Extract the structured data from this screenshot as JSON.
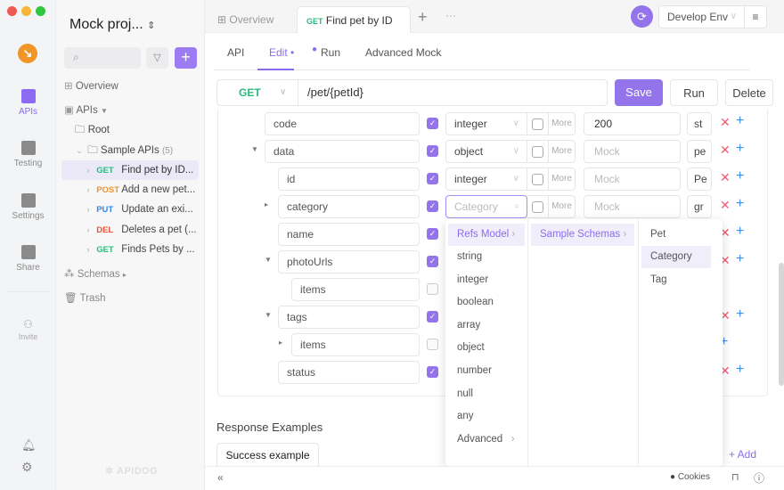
{
  "window": {
    "traffic_colors": [
      "#ee5b55",
      "#f6b53b",
      "#2fc640"
    ]
  },
  "rail": {
    "items": [
      {
        "label": "APIs",
        "icon": "apis-icon",
        "active": true
      },
      {
        "label": "Testing",
        "icon": "testing-icon",
        "active": false
      },
      {
        "label": "Settings",
        "icon": "settings-icon",
        "active": false
      },
      {
        "label": "Share",
        "icon": "share-icon",
        "active": false
      },
      {
        "label": "Invite",
        "icon": "invite-icon",
        "active": false
      }
    ]
  },
  "sidebar": {
    "project": "Mock proj...",
    "project_chevron": "⌃",
    "overview": "Overview",
    "apis": "APIs",
    "root": "Root",
    "folder": "Sample APIs",
    "folder_count": "(5)",
    "endpoints": [
      {
        "method": "GET",
        "label": "Find pet by ID..."
      },
      {
        "method": "POST",
        "label": "Add a new pet..."
      },
      {
        "method": "PUT",
        "label": "Update an exi..."
      },
      {
        "method": "DEL",
        "label": "Deletes a pet (..."
      },
      {
        "method": "GET",
        "label": "Finds Pets by ..."
      }
    ],
    "schemas": "Schemas",
    "trash": "Trash",
    "brand": "APIDOG"
  },
  "tabs": {
    "overview": "Overview",
    "active_method": "GET",
    "active_label": "Find pet by ID",
    "env": "Develop Env"
  },
  "subtabs": [
    "API",
    "Edit •",
    "Run",
    "Advanced Mock"
  ],
  "request": {
    "method": "GET",
    "path": "/pet/{petId}",
    "save": "Save",
    "run": "Run",
    "delete": "Delete"
  },
  "schema_rows": [
    {
      "name": "code",
      "required": true,
      "type": "integer",
      "more": "More",
      "mock": "200",
      "mock_is_value": true,
      "desc": "st",
      "actions": "x+"
    },
    {
      "name": "data",
      "required": true,
      "type": "object",
      "more": "More",
      "mock": "Mock",
      "mock_is_value": false,
      "desc": "pe",
      "actions": "x+"
    },
    {
      "name": "id",
      "required": true,
      "type": "integer",
      "more": "More",
      "mock": "Mock",
      "mock_is_value": false,
      "desc": "Pe",
      "actions": "x+"
    },
    {
      "name": "category",
      "required": true,
      "type": "Category",
      "more": "More",
      "mock": "Mock",
      "mock_is_value": false,
      "desc": "gr",
      "actions": "x+"
    },
    {
      "name": "name",
      "required": true,
      "actions": "x+"
    },
    {
      "name": "photoUrls",
      "required": true,
      "actions": "x+"
    },
    {
      "name": "items",
      "required": false,
      "actions": ""
    },
    {
      "name": "tags",
      "required": true,
      "actions": "x+"
    },
    {
      "name": "items",
      "required": false,
      "actions": "+"
    },
    {
      "name": "status",
      "required": true,
      "actions": "x+"
    }
  ],
  "type_dropdown": {
    "search_placeholder": "Category",
    "col1": [
      "Refs Model",
      "string",
      "integer",
      "boolean",
      "array",
      "object",
      "number",
      "null",
      "any",
      "Advanced"
    ],
    "col2": [
      "Sample Schemas"
    ],
    "col3": [
      "Pet",
      "Category",
      "Tag"
    ],
    "selected": "Category"
  },
  "response": {
    "title": "Response Examples",
    "tab": "Success example",
    "add": "+ Add"
  },
  "footer": {
    "cookies": "Cookies"
  },
  "colors": {
    "accent": "#9474ea",
    "get": "#2bba7e",
    "post": "#f0912c",
    "put": "#2f86f0",
    "del": "#e8533b"
  }
}
